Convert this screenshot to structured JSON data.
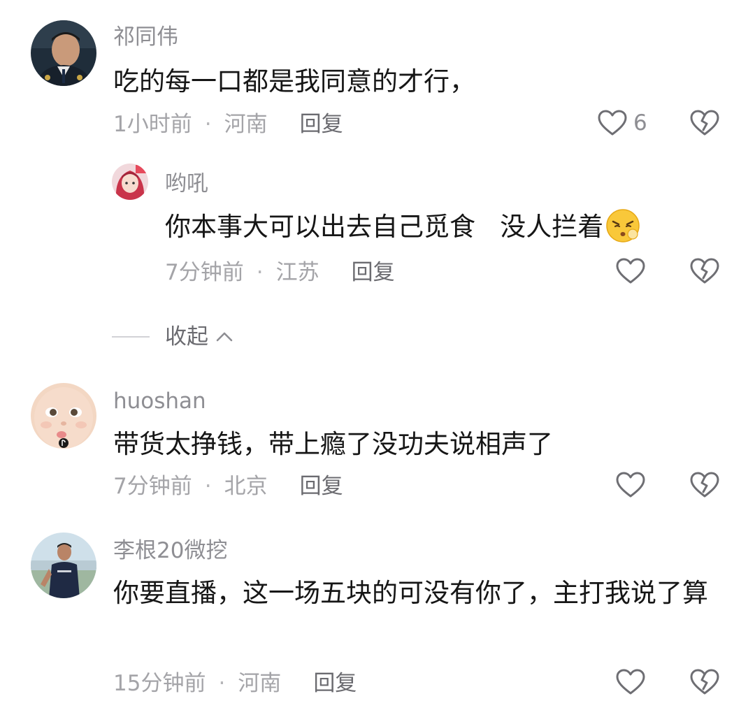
{
  "comments": [
    {
      "username": "祁同伟",
      "text": "吃的每一口都是我同意的才行，",
      "time": "1小时前",
      "location": "河南",
      "reply_label": "回复",
      "like_count": "6",
      "avatar": "avatar-police-officer"
    },
    {
      "username": "哟吼",
      "text": "你本事大可以出去自己觅食   没人拦着",
      "emoji": "pouting-face-emoji",
      "time": "7分钟前",
      "location": "江苏",
      "reply_label": "回复",
      "avatar": "avatar-girl-red-hair"
    },
    {
      "username": "huoshan",
      "text": "带货太挣钱，带上瘾了没功夫说相声了",
      "time": "7分钟前",
      "location": "北京",
      "reply_label": "回复",
      "avatar": "avatar-baby-face"
    },
    {
      "username": "李根20微挖",
      "text": "你要直播，这一场五块的可没有你了，主打我说了算",
      "time": "15分钟前",
      "location": "河南",
      "reply_label": "回复",
      "avatar": "avatar-man-outdoors"
    }
  ],
  "collapse": {
    "label": "收起"
  },
  "meta_separator": "·",
  "colors": {
    "username": "#8e8e93",
    "body_text": "#161616",
    "meta_text": "#a4a4a8",
    "reply_text": "#6b6b70",
    "icon_stroke": "#6e6e73"
  },
  "icons": {
    "like": "heart-outline-icon",
    "dislike": "broken-heart-icon",
    "collapse": "chevron-up-icon"
  }
}
